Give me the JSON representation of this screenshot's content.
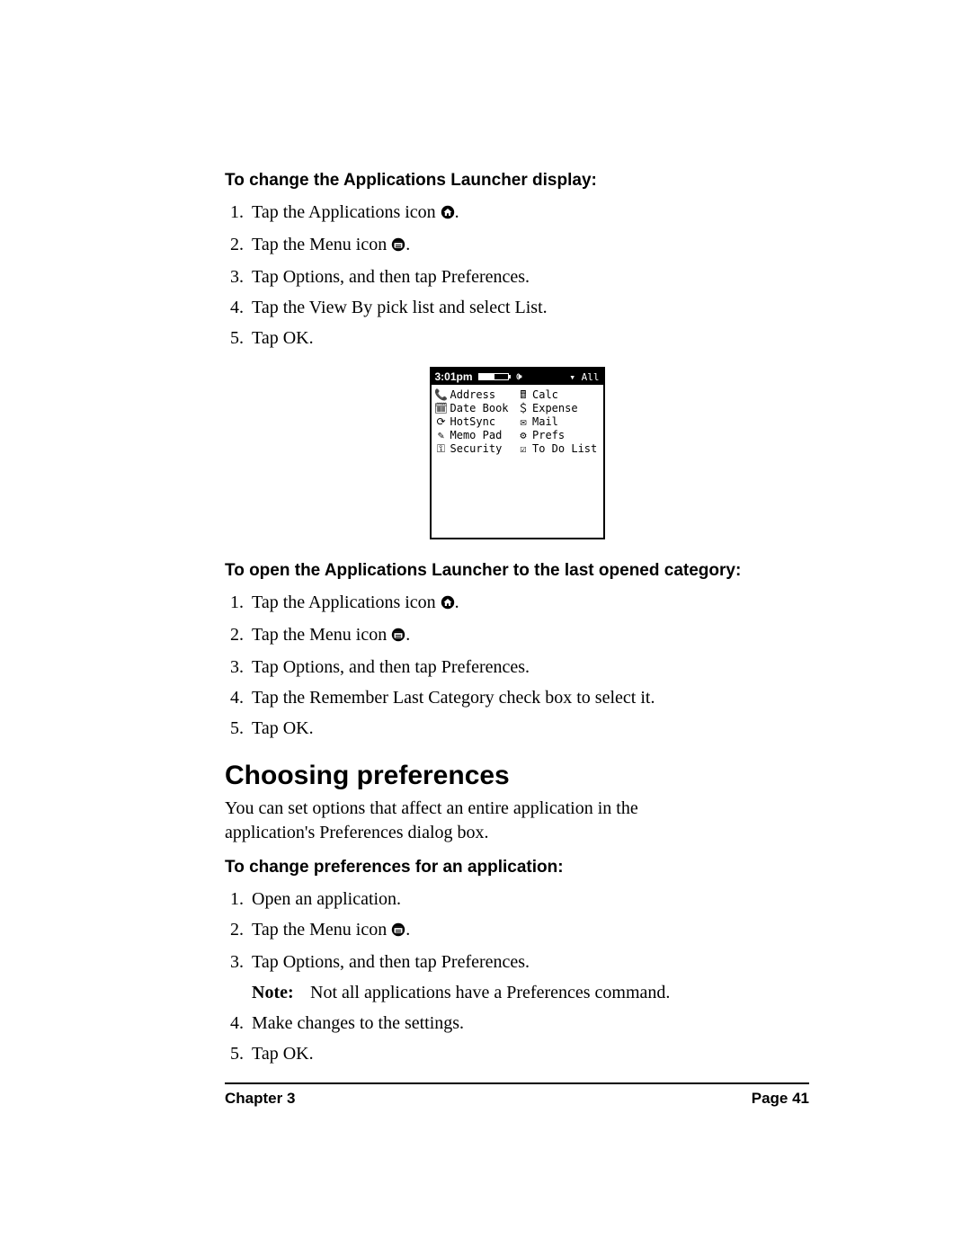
{
  "section1": {
    "heading": "To change the Applications Launcher display:",
    "steps": {
      "s1a": "Tap the Applications icon ",
      "s1b": ".",
      "s2a": "Tap the Menu icon ",
      "s2b": ".",
      "s3": "Tap Options, and then tap Preferences.",
      "s4": "Tap the View By pick list and select List.",
      "s5": "Tap OK."
    }
  },
  "palm": {
    "time": "3:01pm",
    "category_dropdown": "▾ All",
    "left": [
      "Address",
      "Date Book",
      "HotSync",
      "Memo Pad",
      "Security"
    ],
    "right": [
      "Calc",
      "Expense",
      "Mail",
      "Prefs",
      "To Do List"
    ]
  },
  "section2": {
    "heading": "To open the Applications Launcher to the last opened category:",
    "steps": {
      "s1a": "Tap the Applications icon ",
      "s1b": ".",
      "s2a": "Tap the Menu icon ",
      "s2b": ".",
      "s3": "Tap Options, and then tap Preferences.",
      "s4": "Tap the Remember Last Category check box to select it.",
      "s5": "Tap OK."
    }
  },
  "section3": {
    "title": "Choosing preferences",
    "intro": "You can set options that affect an entire application in the application's Preferences dialog box.",
    "heading": "To change preferences for an application:",
    "steps": {
      "s1": "Open an application.",
      "s2a": "Tap the Menu icon ",
      "s2b": ".",
      "s3": "Tap Options, and then tap Preferences.",
      "note_label": "Note:",
      "note_text": "Not all applications have a Preferences command.",
      "s4": "Make changes to the settings.",
      "s5": "Tap OK."
    }
  },
  "footer": {
    "left": "Chapter 3",
    "right": "Page 41"
  }
}
